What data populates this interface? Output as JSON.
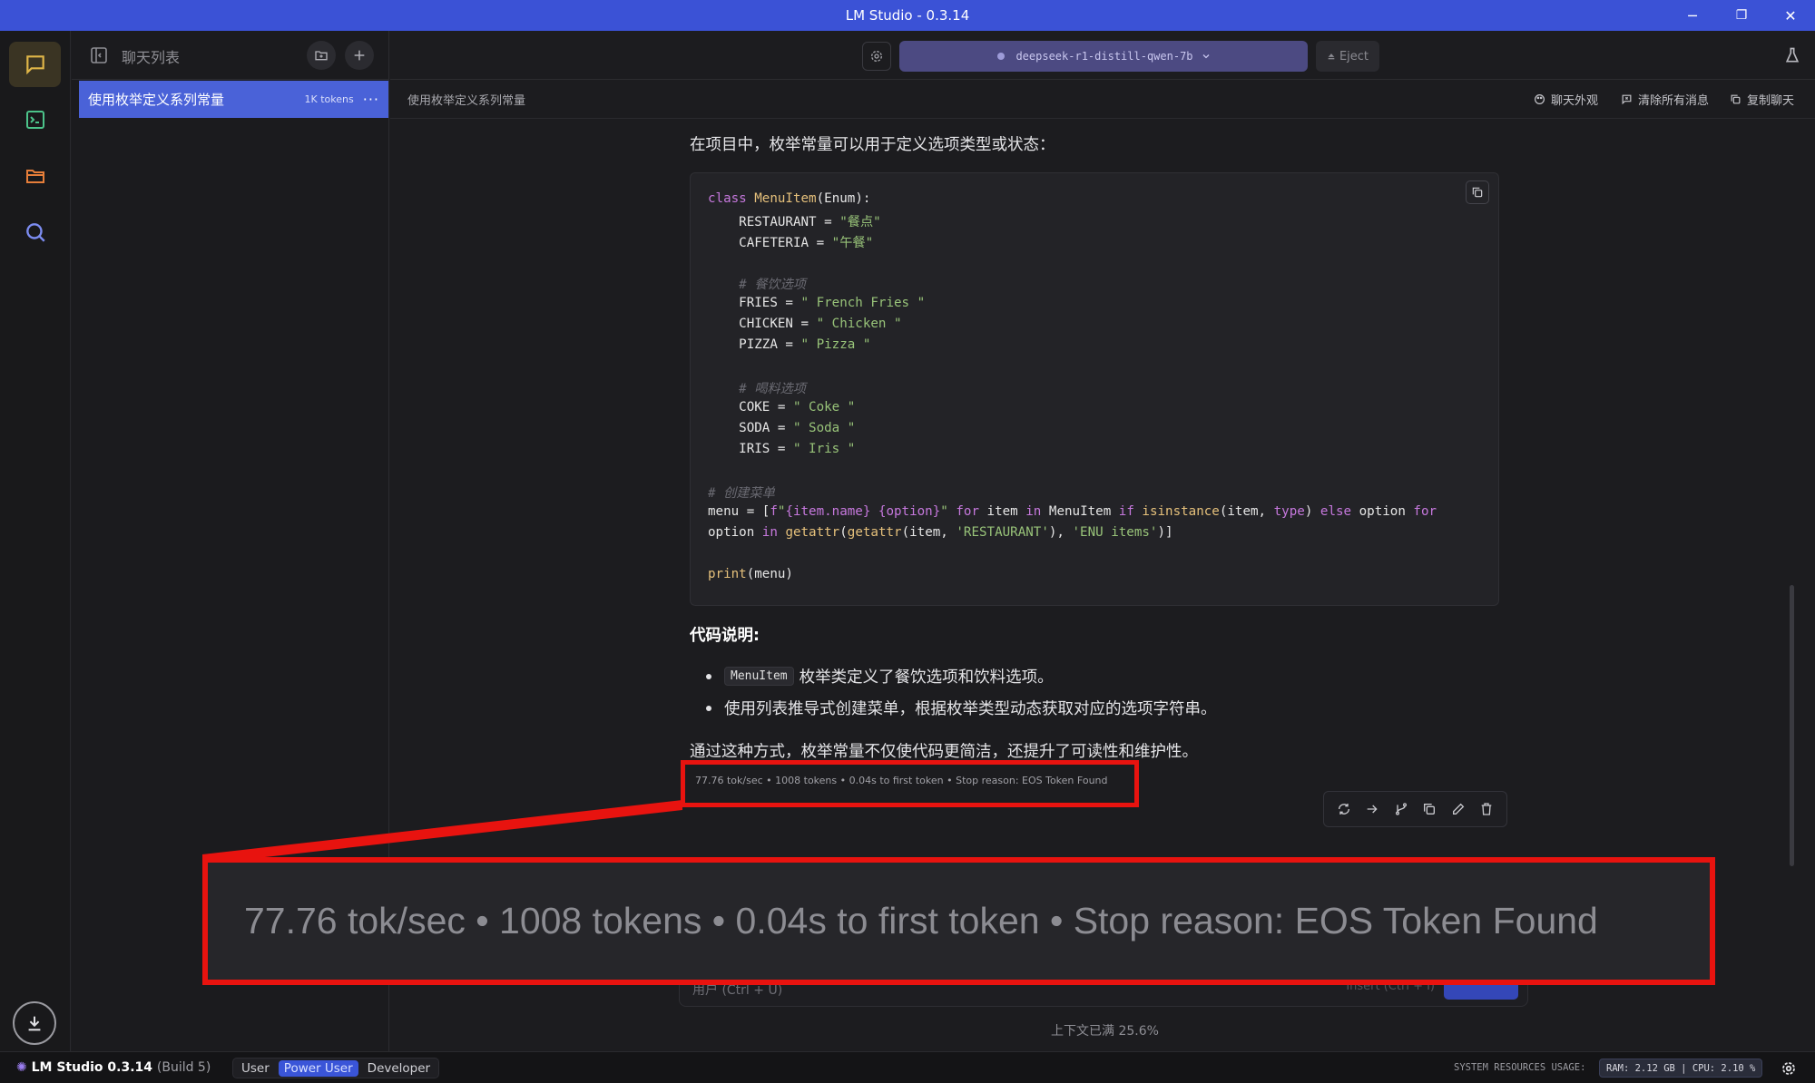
{
  "window": {
    "title": "LM Studio - 0.3.14",
    "controls": {
      "minimize": "─",
      "restore": "❐",
      "close": "✕"
    }
  },
  "sidebar": {
    "title": "聊天列表",
    "items": [
      {
        "name": "使用枚举定义系列常量",
        "tokens": "1K tokens",
        "more": "···"
      }
    ]
  },
  "topbar": {
    "model": "deepseek-r1-distill-qwen-7b",
    "eject": "Eject"
  },
  "subbar": {
    "chat_title": "使用枚举定义系列常量",
    "actions": {
      "appearance": "聊天外观",
      "clear": "清除所有消息",
      "copy": "复制聊天"
    }
  },
  "message": {
    "intro": "在项目中，枚举常量可以用于定义选项类型或状态：",
    "code": {
      "l1": {
        "kw": "class",
        "cls": "MenuItem",
        "rest": "(Enum):"
      },
      "l2": {
        "name": "    RESTAURANT = ",
        "val": "\"餐点\""
      },
      "l3": {
        "name": "    CAFETERIA = ",
        "val": "\"午餐\""
      },
      "l5": "    # 餐饮选项",
      "l6": {
        "name": "    FRIES = ",
        "val": "\" French Fries \""
      },
      "l7": {
        "name": "    CHICKEN = ",
        "val": "\" Chicken \""
      },
      "l8": {
        "name": "    PIZZA = ",
        "val": "\" Pizza \""
      },
      "l10": "    # 喝料选项",
      "l11": {
        "name": "    COKE = ",
        "val": "\" Coke \""
      },
      "l12": {
        "name": "    SODA = ",
        "val": "\" Soda \""
      },
      "l13": {
        "name": "    IRIS = ",
        "val": "\" Iris \""
      },
      "l15": "# 创建菜单",
      "l16": {
        "a": "menu = [",
        "f": "f",
        "q1": "\"",
        "fmt": "{item.name} {option}",
        "q2": "\"",
        "kw1": " for ",
        "b": "item ",
        "kw2": "in",
        "c": " MenuItem ",
        "kw3": "if",
        "sp": " ",
        "fn": "isinstance",
        "d": "(item, ",
        "kw4": "type",
        "e": ") ",
        "kw5": "else",
        "g": " option ",
        "kw6": "for"
      },
      "l17": {
        "a": "option ",
        "kw": "in",
        "sp": " ",
        "fn1": "getattr",
        "p1": "(",
        "fn2": "getattr",
        "b": "(item, ",
        "s1": "'RESTAURANT'",
        "c": "), ",
        "s2": "'ENU items'",
        "d": ")]"
      },
      "l19": {
        "fn": "print",
        "rest": "(menu)"
      }
    },
    "explain_heading": "代码说明:",
    "bullets": [
      {
        "code": "MenuItem",
        "text": "枚举类定义了餐饮选项和饮料选项。"
      },
      {
        "text": "使用列表推导式创建菜单，根据枚举类型动态获取对应的选项字符串。"
      }
    ],
    "conclusion": "通过这种方式，枚举常量不仅使代码更简洁，还提升了可读性和维护性。",
    "stats": "77.76 tok/sec • 1008 tokens • 0.04s to first token • Stop reason: EOS Token Found"
  },
  "zoom_callout": {
    "text": "77.76 tok/sec • 1008 tokens • 0.04s to first token • Stop reason: EOS Token Found",
    "color": "#e8130f"
  },
  "input": {
    "role_label": "用户 (Ctrl + U)",
    "insert": "Insert (Ctrl + I)",
    "context": "上下文已满 25.6%"
  },
  "statusbar": {
    "brand": "LM Studio 0.3.14",
    "build": "(Build 5)",
    "modes": [
      "User",
      "Power User",
      "Developer"
    ],
    "active_mode": "Power User",
    "resources_label": "SYSTEM RESOURCES USAGE:",
    "resources": "RAM: 2.12 GB | CPU: 2.10 %"
  },
  "colors": {
    "accent": "#3b52d6",
    "highlight": "#e8130f"
  }
}
